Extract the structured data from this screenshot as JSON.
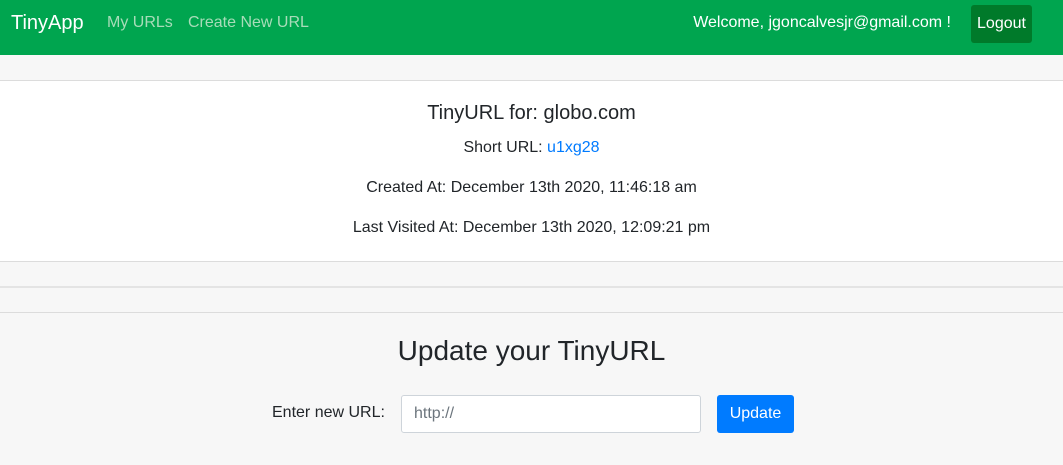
{
  "nav": {
    "brand": "TinyApp",
    "links": [
      {
        "label": "My URLs"
      },
      {
        "label": "Create New URL"
      }
    ],
    "welcome": "Welcome, jgoncalvesjr@gmail.com !",
    "logout_label": "Logout"
  },
  "details": {
    "title": "TinyURL for: globo.com",
    "short_url_prefix": "Short URL: ",
    "short_url": "u1xg28",
    "created_at": "Created At: December 13th 2020, 11:46:18 am",
    "last_visited_at": "Last Visited At: December 13th 2020, 12:09:21 pm"
  },
  "update": {
    "title": "Update your TinyURL",
    "label": "Enter new URL:",
    "placeholder": "http://",
    "button_label": "Update"
  },
  "colors": {
    "navbar": "#00a54f",
    "logout_button": "#007a2a",
    "link": "#007bff",
    "update_button": "#007bff"
  }
}
